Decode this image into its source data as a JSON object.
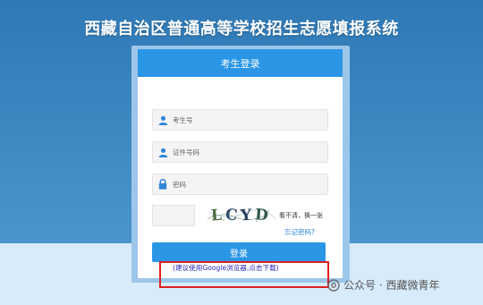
{
  "page": {
    "title": "西藏自治区普通高等学校招生志愿填报系统"
  },
  "login": {
    "header": "考生登录",
    "fields": {
      "candidate_id_placeholder": "考生号",
      "id_number_placeholder": "证件号码",
      "password_placeholder": "密码"
    },
    "captcha": {
      "chars": [
        "L",
        "C",
        "Y",
        "D"
      ],
      "refresh_text": "看不清，换一张"
    },
    "forgot_password": "忘记密码?",
    "submit": "登录",
    "browser_tip": "(建议使用Google浏览器,点击下载)"
  },
  "watermark": {
    "text": "公众号 · 西藏微青年",
    "icon": "wechat-official-account-icon"
  },
  "colors": {
    "background_top": "#3d89c2",
    "background_bottom": "#d7ebfa",
    "accent": "#2b96e6",
    "highlight_border": "#e02020",
    "tip_text": "#2a2ab8"
  }
}
